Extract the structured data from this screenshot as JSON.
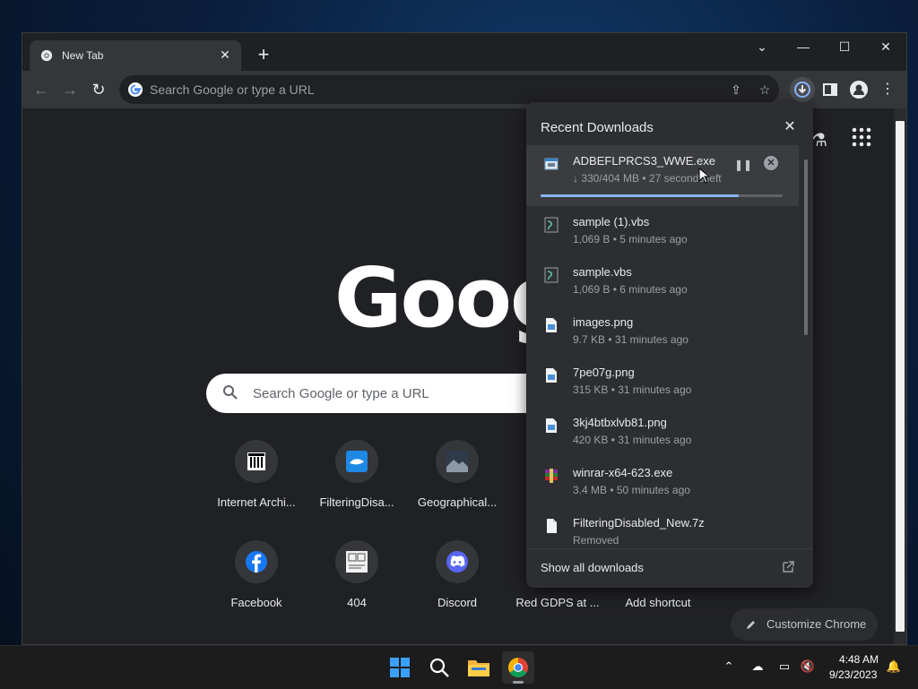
{
  "browser": {
    "tab_title": "New Tab",
    "tab_close": "✕",
    "new_tab": "+",
    "window_controls": {
      "tab_search": "⌄",
      "minimize": "—",
      "maximize": "☐",
      "close": "✕"
    },
    "omnibox_placeholder": "Search Google or type a URL"
  },
  "ntp": {
    "logo_text": "Goog",
    "search_placeholder": "Search Google or type a URL",
    "shortcuts": [
      {
        "label": "Internet Archi...",
        "icon": "internet-archive-icon"
      },
      {
        "label": "FilteringDisa...",
        "icon": "filteringdisabled-icon"
      },
      {
        "label": "Geographical...",
        "icon": "geographical-icon"
      },
      {
        "label": "Facebook",
        "icon": "facebook-icon"
      },
      {
        "label": "404",
        "icon": "404-icon"
      },
      {
        "label": "Discord",
        "icon": "discord-icon"
      },
      {
        "label": "Red GDPS at ...",
        "icon": "red-gdps-icon"
      },
      {
        "label": "Add shortcut",
        "icon": "add-shortcut-icon"
      }
    ],
    "customize_label": "Customize Chrome"
  },
  "downloads": {
    "title": "Recent Downloads",
    "close": "✕",
    "items": [
      {
        "name": "ADBEFLPRCS3_WWE.exe",
        "status": "↓ 330/404 MB • 27 seconds left",
        "progress": 0.82,
        "icon": "exe-icon"
      },
      {
        "name": "sample (1).vbs",
        "status": "1,069 B • 5 minutes ago",
        "icon": "vbs-icon"
      },
      {
        "name": "sample.vbs",
        "status": "1,069 B • 6 minutes ago",
        "icon": "vbs-icon"
      },
      {
        "name": "images.png",
        "status": "9.7 KB • 31 minutes ago",
        "icon": "png-icon"
      },
      {
        "name": "7pe07g.png",
        "status": "315 KB • 31 minutes ago",
        "icon": "png-icon"
      },
      {
        "name": "3kj4btbxlvb81.png",
        "status": "420 KB • 31 minutes ago",
        "icon": "png-icon"
      },
      {
        "name": "winrar-x64-623.exe",
        "status": "3.4 MB • 50 minutes ago",
        "icon": "winrar-icon"
      },
      {
        "name": "FilteringDisabled_New.7z",
        "status": "Removed",
        "icon": "file-icon"
      }
    ],
    "show_all": "Show all downloads"
  },
  "taskbar": {
    "time": "4:48 AM",
    "date": "9/23/2023"
  },
  "colors": {
    "accent": "#8ab4f8",
    "bubble_bg": "#2d2e31",
    "ntp_bg": "#202124"
  }
}
